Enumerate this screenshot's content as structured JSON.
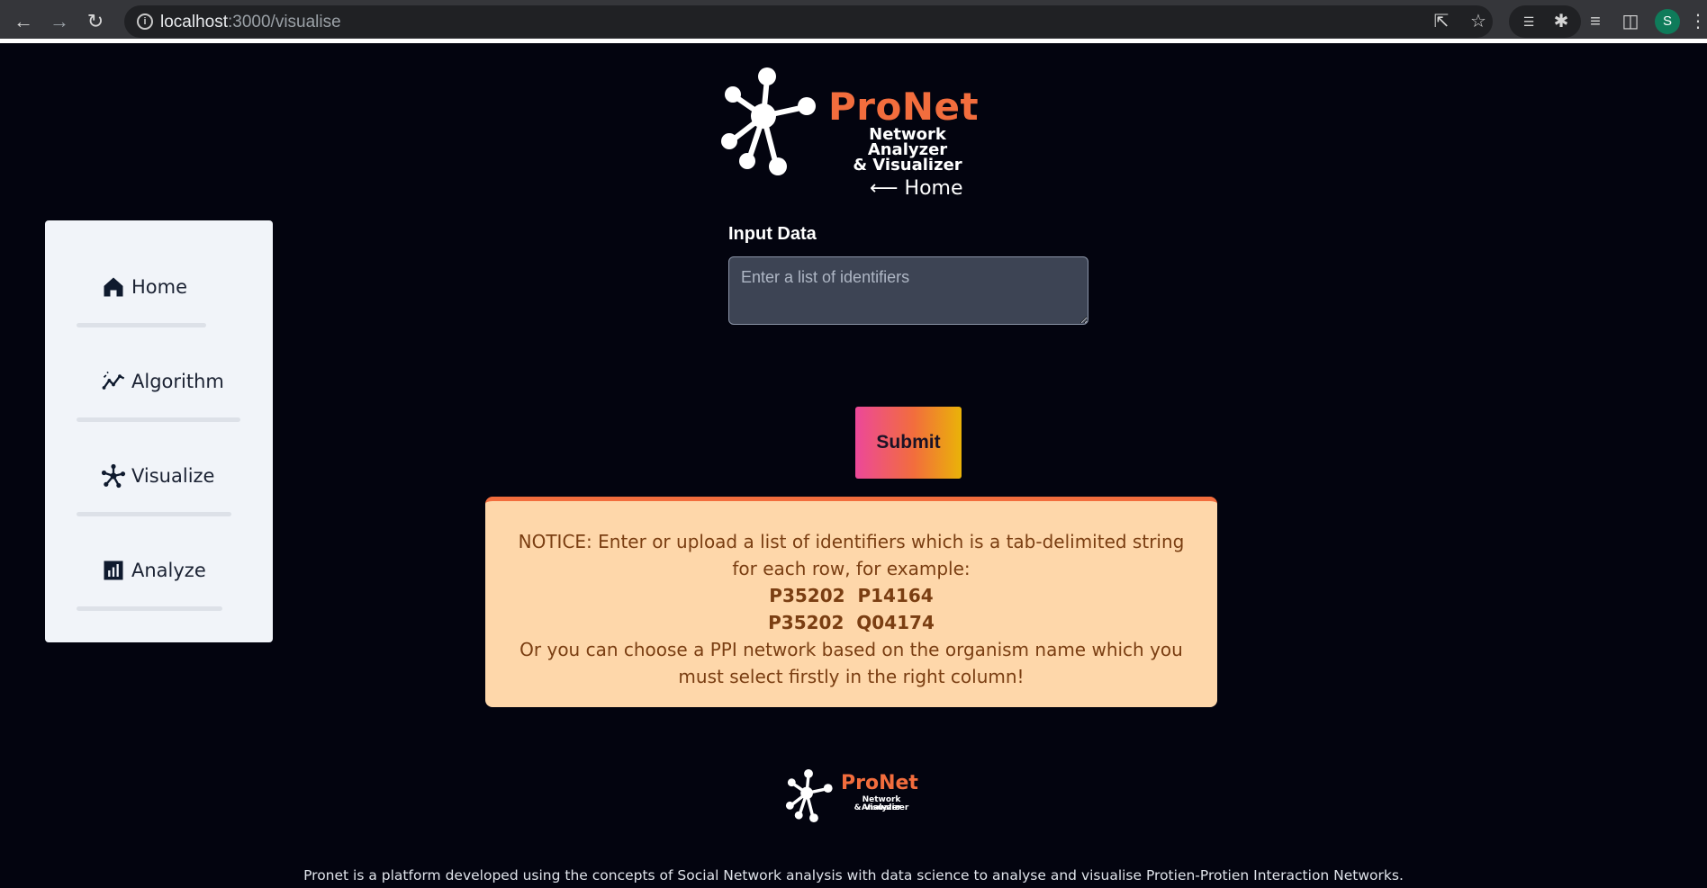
{
  "browser": {
    "url_host": "localhost",
    "url_rest": ":3000/visualise",
    "profile_initial": "S"
  },
  "logo": {
    "brand": "ProNet",
    "tagline_line1": "Network Analyzer",
    "tagline_line2": "& Visualizer"
  },
  "home_link": "Home",
  "sidebar": {
    "items": [
      {
        "label": "Home",
        "icon": "house-icon"
      },
      {
        "label": "Algorithm",
        "icon": "trend-chart-icon"
      },
      {
        "label": "Visualize",
        "icon": "network-icon"
      },
      {
        "label": "Analyze",
        "icon": "bar-chart-icon"
      }
    ]
  },
  "form": {
    "label": "Input Data",
    "placeholder": "Enter a list of identifiers",
    "submit_label": "Submit"
  },
  "notice": {
    "line1": "NOTICE: Enter or upload a list of identifiers which is a tab-delimited string",
    "line2": "for each row, for example:",
    "example1": "P35202  P14164",
    "example2": "P35202  Q04174",
    "line3": "Or you can choose a PPI network based on the organism name which you",
    "line4": "must select firstly in the right column!"
  },
  "footer": {
    "brand": "ProNet",
    "tagline_line1": "Network Analyzer",
    "tagline_line2": "& Visualizer",
    "description": "Pronet is a platform developed using the concepts of Social Network analysis with data science to analyse and visualise Protien-Protien Interaction Networks."
  },
  "colors": {
    "brand_orange": "#f26d3d",
    "background": "#03040f",
    "notice_bg": "#fed7aa",
    "notice_text": "#7a3e12"
  }
}
